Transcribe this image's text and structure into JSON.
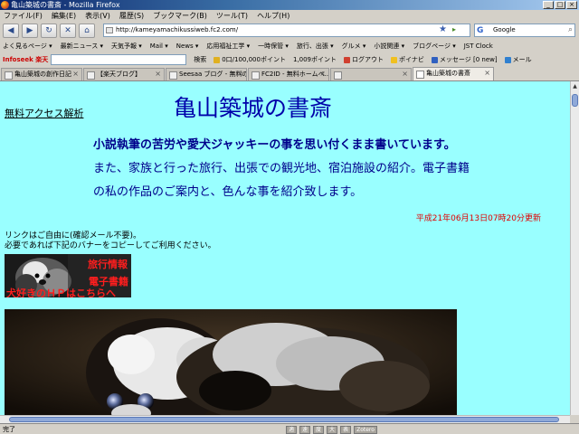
{
  "window": {
    "title": "亀山築城の書斎 - Mozilla Firefox",
    "controls": [
      "_",
      "□",
      "×"
    ]
  },
  "menu": [
    "ファイル(F)",
    "編集(E)",
    "表示(V)",
    "履歴(S)",
    "ブックマーク(B)",
    "ツール(T)",
    "ヘルプ(H)"
  ],
  "nav": {
    "back": "◀",
    "forward": "▶",
    "reload": "↻",
    "stop": "✕",
    "home": "⌂",
    "url": "http://kameyamachikussiweb.fc2.com/",
    "search_placeholder": "Google"
  },
  "bookmarks": [
    "よく見るページ ▾",
    "最新ニュース ▾",
    "天気予報 ▾",
    "Mail ▾",
    "News ▾",
    "応用福祉工学 ▾",
    "一時保管 ▾",
    "旅行、出張 ▾",
    "グルメ ▾",
    "小説関連 ▾",
    "ブログページ ▾",
    "JST Clock"
  ],
  "toolbar2": {
    "logo": "Infoseek 楽天",
    "search_btn": "検索",
    "points": "0口/100,000ポイント",
    "points2": "1,009ポイント",
    "logout": "ログアウト",
    "poinap": "ポイナビ",
    "message": "メッセージ [0 new]",
    "mail": "メール"
  },
  "tabs": [
    {
      "label": "亀山築城の創作日記",
      "active": false
    },
    {
      "label": "【楽天ブログ】",
      "active": false
    },
    {
      "label": "Seesaa ブログ - 無料のブ...",
      "active": false
    },
    {
      "label": "FC2ID - 無料ホームペ...",
      "active": false
    },
    {
      "label": "",
      "active": false
    },
    {
      "label": "亀山築城の書斎",
      "active": true
    }
  ],
  "content": {
    "counter_link": "無料アクセス解析",
    "title": "亀山築城の書斎",
    "intro": [
      "小説執筆の苦労や愛犬ジャッキーの事を思い付くまま書いています。",
      "また、家族と行った旅行、出張での観光地、宿泊施設の紹介。電子書籍",
      "の私の作品のご案内と、色んな事を紹介致します。"
    ],
    "updated": "平成21年06月13日07時20分更新",
    "link_note": [
      "リンクはご自由に(確認メール不要)。",
      "必要であれば下記のバナーをコピーしてご利用ください。"
    ],
    "banner": {
      "line1": "旅行情報",
      "line2": "電子書籍",
      "line3": "犬好きのＨＰはこちらへ"
    }
  },
  "statusbar": {
    "text": "完了",
    "tools": [
      "適",
      "速",
      "度",
      "大",
      "表",
      "Zotero"
    ]
  }
}
